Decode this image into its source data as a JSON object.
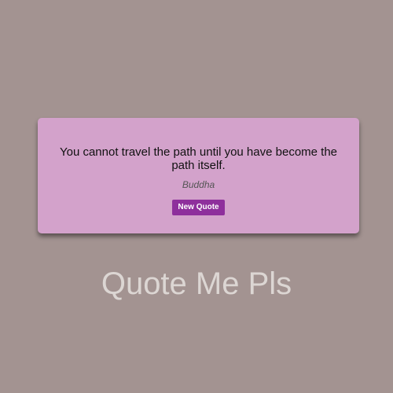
{
  "quote": {
    "text": "You cannot travel the path until you have become the path itself.",
    "author": "Buddha"
  },
  "actions": {
    "new_quote_label": "New Quote"
  },
  "app": {
    "title": "Quote Me Pls"
  },
  "colors": {
    "background": "#a39391",
    "card": "#d3a2cb",
    "button": "#8e2f9c",
    "title": "#dcd6d3"
  }
}
